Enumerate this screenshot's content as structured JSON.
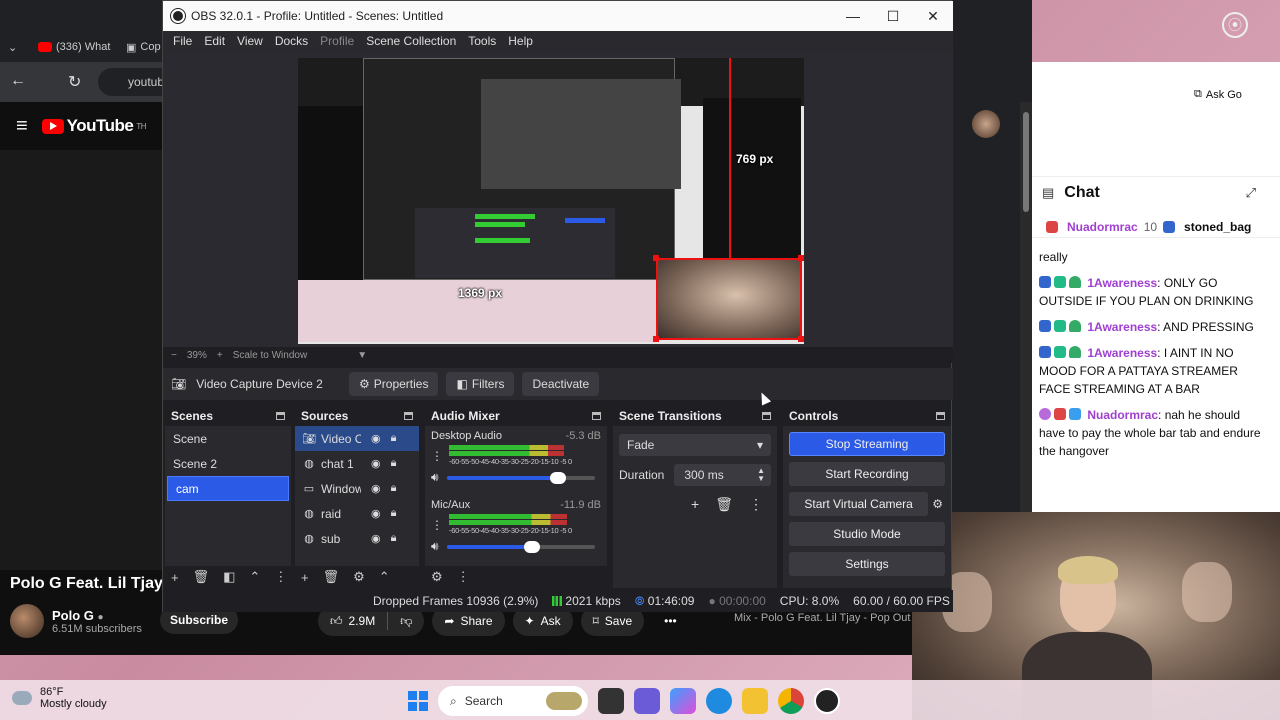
{
  "browser": {
    "tab1": "(336) What",
    "tab2": "Cop",
    "url": "youtub",
    "yt_logo": "YouTube",
    "yt_logo_suffix": "TH",
    "video_title": "Polo G Feat. Lil Tjay",
    "channel_name": "Polo G",
    "channel_subs": "6.51M subscribers",
    "subscribe": "Subscribe",
    "likes": "2.9M",
    "share": "Share",
    "ask": "Ask",
    "save": "Save",
    "more": "•••",
    "mix_item": "Mix - Polo G Feat. Lil Tjay - Pop Out",
    "ask_google": "Ask Go"
  },
  "chat": {
    "title": "Chat",
    "pinned_user1": "Nuadormrac",
    "pinned_count": "10",
    "pinned_user2": "stoned_bag",
    "messages": [
      {
        "author": "",
        "text": "really"
      },
      {
        "author": "1Awareness",
        "text": ": ONLY GO OUTSIDE IF YOU PLAN ON DRINKING"
      },
      {
        "author": "1Awareness",
        "text": ": AND PRESSING"
      },
      {
        "author": "1Awareness",
        "text": ": I AINT IN NO MOOD FOR A PATTAYA STREAMER FACE STREAMING AT A BAR"
      },
      {
        "author": "Nuadormrac",
        "text": ": nah he should have to pay the whole bar tab and endure the hangover"
      }
    ]
  },
  "obs": {
    "window_title": "OBS 32.0.1 - Profile: Untitled - Scenes: Untitled",
    "menu": [
      "File",
      "Edit",
      "View",
      "Docks",
      "Profile",
      "Scene Collection",
      "Tools",
      "Help"
    ],
    "preview": {
      "height_label": "769 px",
      "width_label": "1369 px",
      "zoom": "39%",
      "scale_mode": "Scale to Window"
    },
    "source_toolbar": {
      "source_name": "Video Capture Device 2",
      "properties": "Properties",
      "filters": "Filters",
      "deactivate": "Deactivate"
    },
    "scenes": {
      "title": "Scenes",
      "items": [
        "Scene",
        "Scene 2",
        "cam"
      ]
    },
    "sources": {
      "title": "Sources",
      "items": [
        "Video C",
        "chat 1",
        "Window",
        "raid",
        "sub"
      ]
    },
    "mixer": {
      "title": "Audio Mixer",
      "channels": [
        {
          "name": "Desktop Audio",
          "db": "-5.3 dB",
          "level": 0.78,
          "volume": 0.75
        },
        {
          "name": "Mic/Aux",
          "db": "-11.9 dB",
          "level": 0.8,
          "volume": 0.58
        }
      ],
      "scale": "-60-55-50-45-40-35-30-25-20-15-10 -5 0"
    },
    "transitions": {
      "title": "Scene Transitions",
      "type": "Fade",
      "duration_label": "Duration",
      "duration": "300 ms"
    },
    "controls": {
      "title": "Controls",
      "stop_streaming": "Stop Streaming",
      "start_recording": "Start Recording",
      "start_virtual_camera": "Start Virtual Camera",
      "studio_mode": "Studio Mode",
      "settings": "Settings"
    },
    "status": {
      "dropped": "Dropped Frames 10936 (2.9%)",
      "bitrate": "2021 kbps",
      "stream_time": "01:46:09",
      "rec_time": "00:00:00",
      "cpu": "CPU: 8.0%",
      "fps": "60.00 / 60.00 FPS"
    }
  },
  "taskbar": {
    "temp": "86°F",
    "weather": "Mostly cloudy",
    "search": "Search"
  }
}
